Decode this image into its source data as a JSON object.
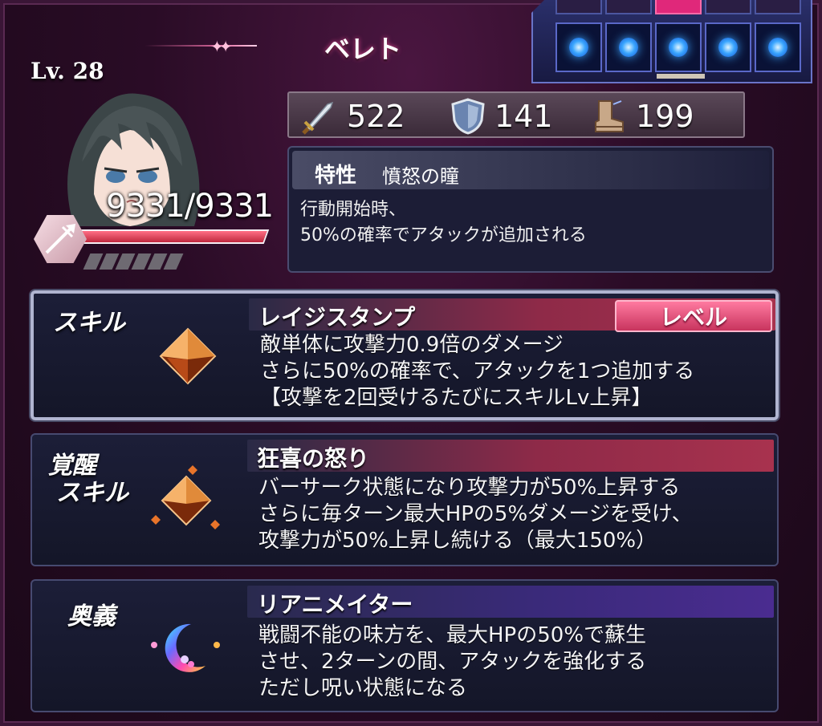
{
  "character": {
    "name": "ベレト",
    "level": "Lv. 28",
    "hp": "9331/9331",
    "hp_fraction": 1.0,
    "weapon_icon": "spear-icon"
  },
  "slots": {
    "count": 5,
    "active_top_index": 2,
    "dot_color": "#3aa6ff"
  },
  "stats": [
    {
      "icon": "sword-icon",
      "value": "522"
    },
    {
      "icon": "shield-icon",
      "value": "141"
    },
    {
      "icon": "boot-icon",
      "value": "199"
    }
  ],
  "trait": {
    "label": "特性",
    "name": "憤怒の瞳",
    "lines": [
      "行動開始時、",
      "50%の確率でアタックが追加される"
    ]
  },
  "skills": [
    {
      "tag": [
        "スキル"
      ],
      "name": "レイジスタンプ",
      "button": "レベル",
      "icon": "orange-crystal-icon",
      "lines": [
        "敵単体に攻撃力0.9倍のダメージ",
        "さらに50%の確率で、アタックを1つ追加する",
        "【攻撃を2回受けるたびにスキルLv上昇】"
      ]
    },
    {
      "tag": [
        "覚醒",
        "スキル"
      ],
      "name": "狂喜の怒り",
      "icon": "crystal-cluster-icon",
      "lines": [
        "バーサーク状態になり攻撃力が50%上昇する",
        "さらに毎ターン最大HPの5%ダメージを受け、",
        "攻撃力が50%上昇し続ける（最大150%）"
      ]
    },
    {
      "tag": [
        "奥義"
      ],
      "name": "リアニメイター",
      "icon": "rainbow-moon-icon",
      "lines": [
        "戦闘不能の味方を、最大HPの50%で蘇生",
        "させ、2ターンの間、アタックを強化する",
        "ただし呪い状態になる"
      ]
    }
  ],
  "colors": {
    "accent": "#c8345e",
    "ultimate": "#4a2c90"
  }
}
